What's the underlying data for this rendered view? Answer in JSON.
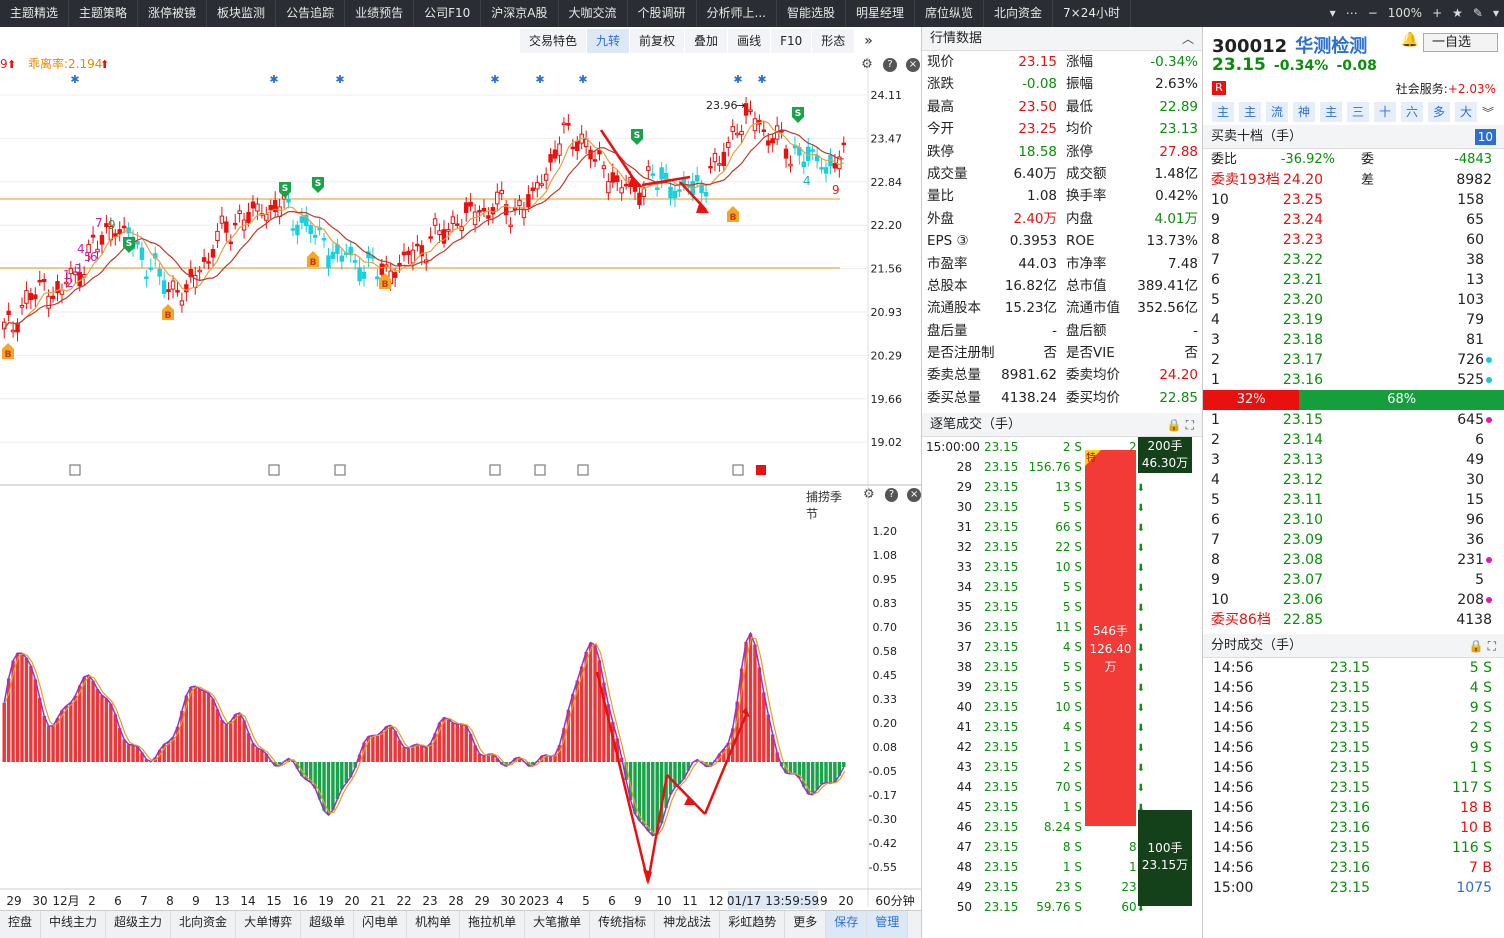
{
  "topnav": {
    "tabs": [
      "主题精选",
      "主题策略",
      "涨停被镜",
      "板块监测",
      "公告追踪",
      "业绩预告",
      "公司F10",
      "沪深京A股",
      "大咖交流",
      "个股调研",
      "分析师上...",
      "智能选股",
      "明星经理",
      "席位纵览",
      "北向资金",
      "7×24小时"
    ],
    "zoom": "100%"
  },
  "toolbar": {
    "items": [
      "交易特色",
      "九转",
      "前复权",
      "叠加",
      "画线",
      "F10",
      "形态"
    ],
    "selected": "九转"
  },
  "kchart": {
    "indicator_label": "乖离率:2.194",
    "prefix_label": "9",
    "price_ticks": [
      "24.11",
      "23.47",
      "22.84",
      "22.20",
      "21.56",
      "20.93",
      "20.29",
      "19.66",
      "19.02"
    ],
    "high_label": "23.96",
    "markers_B": [
      "B",
      "B",
      "B",
      "B",
      "B"
    ],
    "markers_S": [
      "S",
      "S",
      "S",
      "S",
      "S"
    ],
    "nine_labels": [
      "9",
      "7",
      "4",
      "5",
      "6",
      "3",
      "2",
      "1",
      "4",
      "9"
    ]
  },
  "subchart": {
    "title": "捕捞季节",
    "ticks": [
      "1.20",
      "1.08",
      "0.95",
      "0.83",
      "0.70",
      "0.58",
      "0.45",
      "0.33",
      "0.20",
      "0.08",
      "-0.05",
      "-0.17",
      "-0.30",
      "-0.42",
      "-0.55"
    ]
  },
  "xaxis": {
    "labels": [
      "29",
      "30",
      "12月",
      "2",
      "6",
      "7",
      "8",
      "9",
      "13",
      "14",
      "15",
      "16",
      "19",
      "20",
      "21",
      "22",
      "23",
      "28",
      "29",
      "30",
      "2023",
      "4",
      "5",
      "6",
      "9",
      "10",
      "11",
      "12",
      "16",
      "17",
      "18",
      "19",
      "20"
    ],
    "cursor_label": "01/17 13:59:59",
    "period": "60分钟"
  },
  "bottom_tabs": [
    "控盘",
    "中线主力",
    "超级主力",
    "北向资金",
    "大单博弈",
    "超级单",
    "闪电单",
    "机构单",
    "拖拉机单",
    "大笔撤单",
    "传统指标",
    "神龙战法",
    "彩虹趋势",
    "更多",
    "保存",
    "管理"
  ],
  "quote": {
    "title": "行情数据",
    "rows": [
      [
        "现价",
        "23.15",
        "red",
        "涨幅",
        "-0.34%",
        "green"
      ],
      [
        "涨跌",
        "-0.08",
        "green",
        "振幅",
        "2.63%",
        "blk"
      ],
      [
        "最高",
        "23.50",
        "red",
        "最低",
        "22.89",
        "green"
      ],
      [
        "今开",
        "23.25",
        "red",
        "均价",
        "23.13",
        "green"
      ],
      [
        "跌停",
        "18.58",
        "green",
        "涨停",
        "27.88",
        "red"
      ],
      [
        "成交量",
        "6.40万",
        "blk",
        "成交额",
        "1.48亿",
        "blk"
      ],
      [
        "量比",
        "1.08",
        "blk",
        "换手率",
        "0.42%",
        "blk"
      ],
      [
        "外盘",
        "2.40万",
        "red",
        "内盘",
        "4.01万",
        "green"
      ],
      [
        "EPS ③",
        "0.3953",
        "blk",
        "ROE",
        "13.73%",
        "blk"
      ],
      [
        "市盈率",
        "44.03",
        "blk",
        "市净率",
        "7.48",
        "blk"
      ],
      [
        "总股本",
        "16.82亿",
        "blk",
        "总市值",
        "389.41亿",
        "blk"
      ],
      [
        "流通股本",
        "15.23亿",
        "blk",
        "流通市值",
        "352.56亿",
        "blk"
      ],
      [
        "盘后量",
        "-",
        "blk",
        "盘后额",
        "-",
        "blk"
      ],
      [
        "是否注册制",
        "否",
        "blk",
        "是否VIE",
        "否",
        "blk"
      ],
      [
        "委卖总量",
        "8981.62",
        "blk",
        "委卖均价",
        "24.20",
        "red"
      ],
      [
        "委买总量",
        "4138.24",
        "blk",
        "委买均价",
        "22.85",
        "green"
      ]
    ]
  },
  "ticks": {
    "title": "逐笔成交（手）",
    "first": [
      "15:00:00",
      "23.15",
      "2 S",
      "2"
    ],
    "rows": [
      [
        "28",
        "23.15",
        "156.76 S",
        "特"
      ],
      [
        "29",
        "23.15",
        "13 S",
        "13"
      ],
      [
        "30",
        "23.15",
        "5 S",
        "5"
      ],
      [
        "31",
        "23.15",
        "66 S",
        "66"
      ],
      [
        "32",
        "23.15",
        "22 S",
        "22"
      ],
      [
        "33",
        "23.15",
        "10 S",
        "10"
      ],
      [
        "34",
        "23.15",
        "5 S",
        "5"
      ],
      [
        "35",
        "23.15",
        "5 S",
        "5"
      ],
      [
        "36",
        "23.15",
        "11 S",
        "11"
      ],
      [
        "37",
        "23.15",
        "4 S",
        "4"
      ],
      [
        "38",
        "23.15",
        "5 S",
        "5"
      ],
      [
        "39",
        "23.15",
        "5 S",
        "5"
      ],
      [
        "40",
        "23.15",
        "10 S",
        "10"
      ],
      [
        "41",
        "23.15",
        "4 S",
        "4"
      ],
      [
        "42",
        "23.15",
        "1 S",
        "1"
      ],
      [
        "43",
        "23.15",
        "2 S",
        "2"
      ],
      [
        "44",
        "23.15",
        "70 S",
        "70"
      ],
      [
        "45",
        "23.15",
        "1 S",
        "1"
      ],
      [
        "46",
        "23.15",
        "8.24 S",
        ""
      ],
      [
        "47",
        "23.15",
        "8 S",
        "8"
      ],
      [
        "48",
        "23.15",
        "1 S",
        "1"
      ],
      [
        "49",
        "23.15",
        "23 S",
        "23"
      ],
      [
        "50",
        "23.15",
        "59.76 S",
        "60"
      ]
    ],
    "block_top": [
      "200手",
      "46.30万"
    ],
    "block_mid": [
      "546手",
      "126.40万"
    ],
    "block_bot": [
      "100手",
      "23.15万"
    ]
  },
  "stock": {
    "code": "300012",
    "name": "华测检测",
    "price": "23.15",
    "change_pct": "-0.34%",
    "change": "-0.08",
    "badge": "R",
    "service_label": "社会服务:",
    "service_pct": "+2.03%",
    "watch_label": "一自选",
    "tags": [
      "主",
      "主",
      "流",
      "神",
      "主",
      "三",
      "十",
      "六",
      "多",
      "大"
    ]
  },
  "orderbook": {
    "title": "买卖十档（手）",
    "title_badge": "10",
    "wb_label": "委比",
    "wb_val": "-36.92%",
    "wc_label": "委差",
    "wc_val": "-4843",
    "sell_head": [
      "委卖193档",
      "24.20",
      "8982"
    ],
    "sells": [
      [
        "10",
        "23.25",
        "158",
        ""
      ],
      [
        "9",
        "23.24",
        "65",
        ""
      ],
      [
        "8",
        "23.23",
        "60",
        ""
      ],
      [
        "7",
        "23.22",
        "38",
        ""
      ],
      [
        "6",
        "23.21",
        "13",
        ""
      ],
      [
        "5",
        "23.20",
        "103",
        ""
      ],
      [
        "4",
        "23.19",
        "79",
        ""
      ],
      [
        "3",
        "23.18",
        "81",
        ""
      ],
      [
        "2",
        "23.17",
        "726",
        "#19c6d8"
      ],
      [
        "1",
        "23.16",
        "525",
        "#19c6d8"
      ]
    ],
    "bar_left": "32%",
    "bar_right": "68%",
    "buys": [
      [
        "1",
        "23.15",
        "645",
        "#e01ab0"
      ],
      [
        "2",
        "23.14",
        "6",
        ""
      ],
      [
        "3",
        "23.13",
        "49",
        ""
      ],
      [
        "4",
        "23.12",
        "30",
        ""
      ],
      [
        "5",
        "23.11",
        "15",
        ""
      ],
      [
        "6",
        "23.10",
        "96",
        ""
      ],
      [
        "7",
        "23.09",
        "36",
        ""
      ],
      [
        "8",
        "23.08",
        "231",
        "#e01ab0"
      ],
      [
        "9",
        "23.07",
        "5",
        ""
      ],
      [
        "10",
        "23.06",
        "208",
        "#e01ab0"
      ]
    ],
    "buy_head": [
      "委买86档",
      "22.85",
      "4138"
    ]
  },
  "minute_trades": {
    "title": "分时成交（手）",
    "rows": [
      [
        "14:56",
        "23.15",
        "5 S"
      ],
      [
        "14:56",
        "23.15",
        "4 S"
      ],
      [
        "14:56",
        "23.15",
        "9 S"
      ],
      [
        "14:56",
        "23.15",
        "2 S"
      ],
      [
        "14:56",
        "23.15",
        "9 S"
      ],
      [
        "14:56",
        "23.15",
        "1 S"
      ],
      [
        "14:56",
        "23.15",
        "117 S"
      ],
      [
        "14:56",
        "23.16",
        "18 B"
      ],
      [
        "14:56",
        "23.16",
        "10 B"
      ],
      [
        "14:56",
        "23.15",
        "116 S"
      ],
      [
        "14:56",
        "23.16",
        "7 B"
      ],
      [
        "15:00",
        "23.15",
        "1075"
      ]
    ]
  }
}
